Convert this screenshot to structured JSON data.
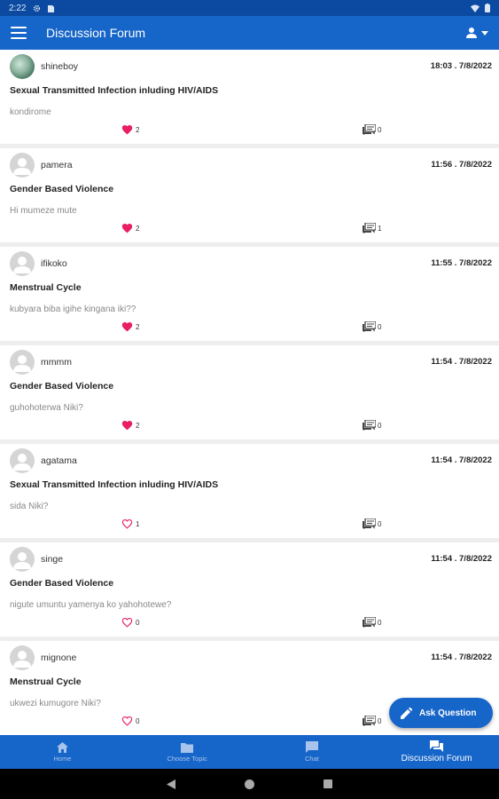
{
  "status_bar": {
    "time": "2:22",
    "icons": [
      "gear-icon",
      "sim-icon",
      "wifi-icon",
      "battery-icon"
    ]
  },
  "app_bar": {
    "title": "Discussion Forum",
    "menu_icon": "menu-icon",
    "account_icon": "account-icon"
  },
  "posts": [
    {
      "username": "shineboy",
      "time": "18:03 . 7/8/2022",
      "topic": "Sexual Transmitted Infection inluding HIV/AIDS",
      "question": "kondirome",
      "likes": "2",
      "liked": true,
      "comments": "0",
      "avatar": "photo"
    },
    {
      "username": "pamera",
      "time": "11:56 . 7/8/2022",
      "topic": "Gender Based Violence",
      "question": "Hi mumeze mute",
      "likes": "2",
      "liked": true,
      "comments": "1",
      "avatar": "default"
    },
    {
      "username": "ifikoko",
      "time": "11:55 . 7/8/2022",
      "topic": "Menstrual Cycle",
      "question": "kubyara biba igihe kingana iki??",
      "likes": "2",
      "liked": true,
      "comments": "0",
      "avatar": "default"
    },
    {
      "username": "mmmm",
      "time": "11:54 . 7/8/2022",
      "topic": "Gender Based Violence",
      "question": "guhohoterwa Niki?",
      "likes": "2",
      "liked": true,
      "comments": "0",
      "avatar": "default"
    },
    {
      "username": "agatama",
      "time": "11:54 . 7/8/2022",
      "topic": "Sexual Transmitted Infection inluding HIV/AIDS",
      "question": "sida Niki?",
      "likes": "1",
      "liked": false,
      "comments": "0",
      "avatar": "default"
    },
    {
      "username": "singe",
      "time": "11:54 . 7/8/2022",
      "topic": "Gender Based Violence",
      "question": "nigute umuntu yamenya ko yahohotewe?",
      "likes": "0",
      "liked": false,
      "comments": "0",
      "avatar": "default"
    },
    {
      "username": "mignone",
      "time": "11:54 . 7/8/2022",
      "topic": "Menstrual Cycle",
      "question": "ukwezi kumugore Niki?",
      "likes": "0",
      "liked": false,
      "comments": "0",
      "avatar": "default"
    }
  ],
  "fab": {
    "label": "Ask Question",
    "icon": "pencil-icon"
  },
  "bottom_nav": [
    {
      "label": "Home",
      "icon": "home-icon",
      "active": false
    },
    {
      "label": "Choose Topic",
      "icon": "folder-icon",
      "active": false
    },
    {
      "label": "Chat",
      "icon": "chat-icon",
      "active": false
    },
    {
      "label": "Discussion Forum",
      "icon": "forum-icon",
      "active": true
    }
  ],
  "colors": {
    "primary": "#1665c8",
    "status_bar": "#0b4aa0",
    "like": "#e91e63",
    "background": "#eeeeee"
  }
}
